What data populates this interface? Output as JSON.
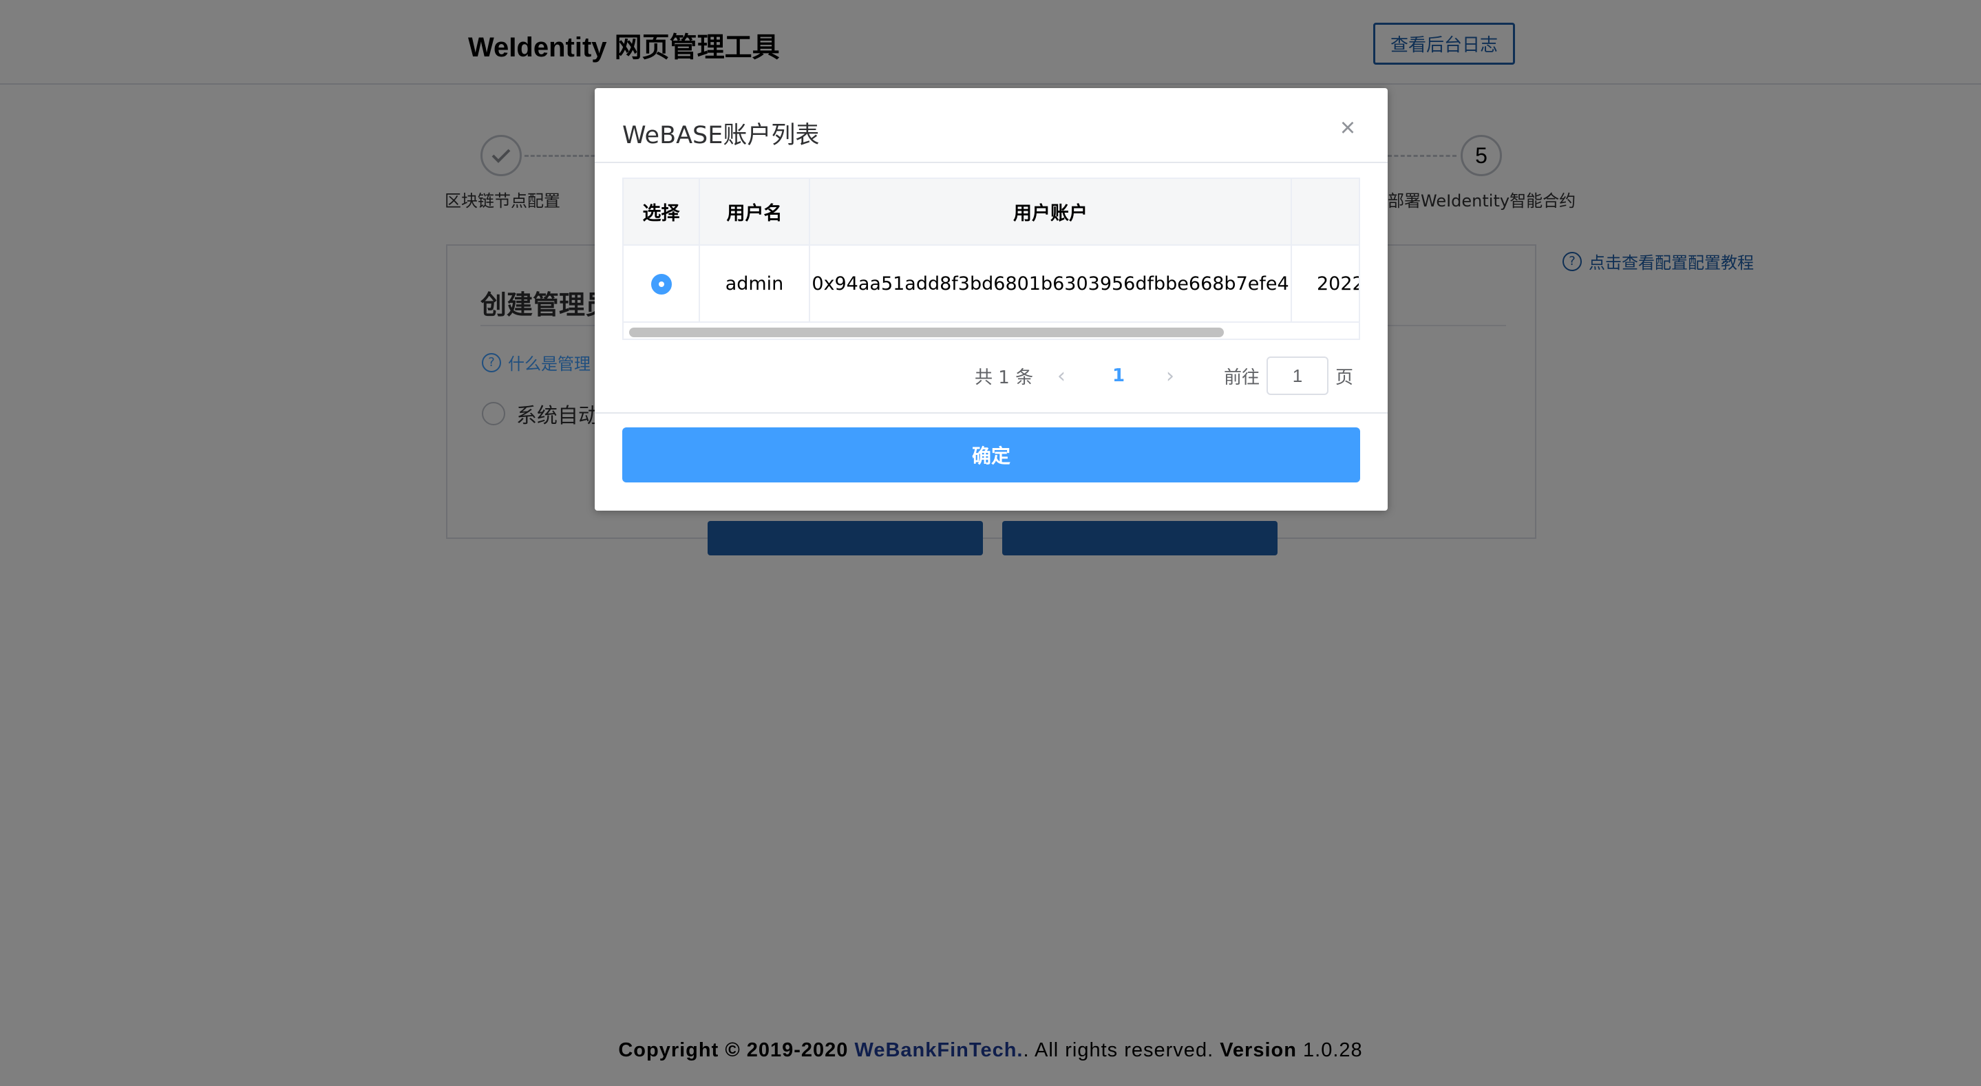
{
  "header": {
    "title": "WeIdentity 网页管理工具",
    "log_button": "查看后台日志"
  },
  "steps": [
    {
      "marker": "✓",
      "label": "区块链节点配置"
    },
    {
      "marker": "5",
      "label": "部署WeIdentity智能合约"
    }
  ],
  "main_card": {
    "title": "创建管理员",
    "help_link": "什么是管理",
    "radio_label": "系统自动"
  },
  "side_help": "点击查看配置配置教程",
  "icons": {
    "step_done": "check-icon",
    "help": "question-circle-icon",
    "close": "close-icon",
    "prev": "chevron-left-icon",
    "next": "chevron-right-icon"
  },
  "dialog": {
    "title": "WeBASE账户列表",
    "close_glyph": "×",
    "table": {
      "headers": [
        "选择",
        "用户名",
        "用户账户",
        ""
      ],
      "rows": [
        {
          "selected": true,
          "username": "admin",
          "account": "0x94aa51add8f3bd6801b6303956dfbbe668b7efe4",
          "extra": "2022"
        }
      ]
    },
    "pagination": {
      "total": "共 1 条",
      "prev": "‹",
      "current": "1",
      "next": "›",
      "goto": "前往",
      "page_input": "1",
      "page_suffix": "页"
    },
    "confirm": "确定"
  },
  "footer": {
    "copyright": "Copyright © 2019-2020",
    "company": "WeBankFinTech.",
    "rights": ". All rights reserved.",
    "version_label": "Version",
    "version": "1.0.28"
  },
  "colors": {
    "primary": "#409eff",
    "brand_dark": "#1f5fa8",
    "mask": "rgba(0,0,0,0.5)"
  }
}
